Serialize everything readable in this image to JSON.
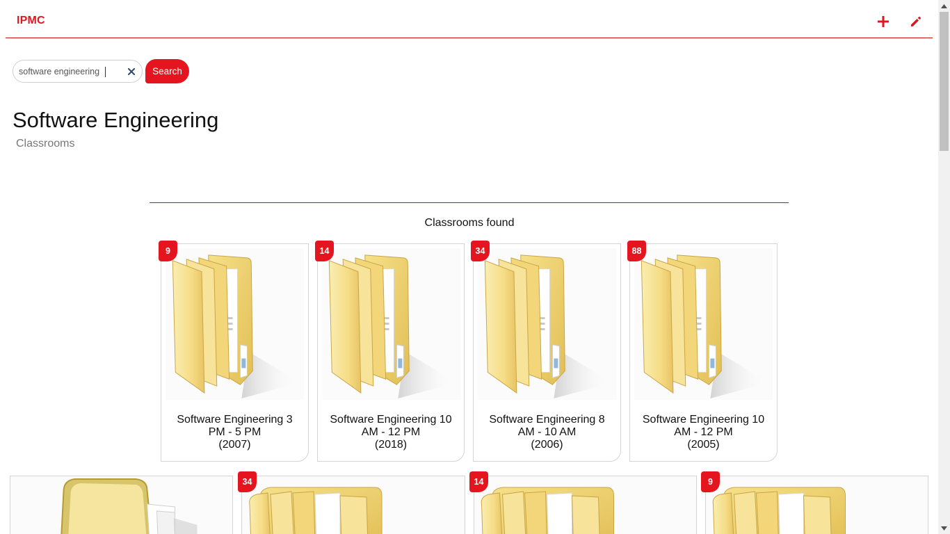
{
  "app": {
    "brand": "IPMC"
  },
  "accent_color": "#e4151f",
  "toolbar": {
    "add_icon": "plus-icon",
    "edit_icon": "pencil-icon"
  },
  "search": {
    "value": "software engineering",
    "button_label": "Search",
    "clear_icon": "close-icon"
  },
  "page": {
    "title": "Software Engineering",
    "subtitle": "Classrooms"
  },
  "results": {
    "label": "Classrooms found",
    "classrooms": [
      {
        "count": "9",
        "line1": "Software Engineering 3",
        "line2": "PM - 5 PM",
        "year": "(2007)"
      },
      {
        "count": "14",
        "line1": "Software Engineering 10",
        "line2": "AM - 12 PM",
        "year": "(2018)"
      },
      {
        "count": "34",
        "line1": "Software Engineering 8",
        "line2": "AM - 10 AM",
        "year": "(2006)"
      },
      {
        "count": "88",
        "line1": "Software Engineering 10",
        "line2": "AM - 12 PM",
        "year": "(2005)"
      }
    ],
    "row2_counts": [
      "34",
      "14",
      "9"
    ]
  }
}
